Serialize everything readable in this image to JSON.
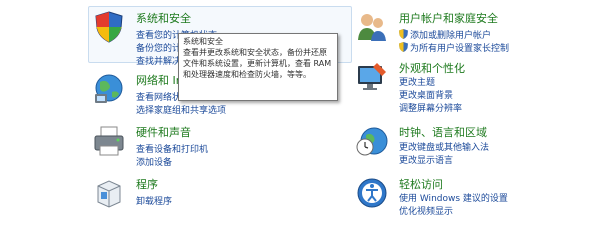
{
  "categories": [
    {
      "key": "system",
      "title": "系统和安全",
      "links": [
        "查看您的计算机状态",
        "备份您的计算机",
        "查找并解决问题"
      ]
    },
    {
      "key": "network",
      "title": "网络和 Internet",
      "links": [
        "查看网络状态和任务",
        "选择家庭组和共享选项"
      ]
    },
    {
      "key": "hardware",
      "title": "硬件和声音",
      "links": [
        "查看设备和打印机",
        "添加设备"
      ]
    },
    {
      "key": "programs",
      "title": "程序",
      "links": [
        "卸载程序"
      ]
    },
    {
      "key": "users",
      "title": "用户帐户和家庭安全",
      "links": [
        "添加或删除用户帐户",
        "为所有用户设置家长控制"
      ]
    },
    {
      "key": "appearance",
      "title": "外观和个性化",
      "links": [
        "更改主题",
        "更改桌面背景",
        "调整屏幕分辨率"
      ]
    },
    {
      "key": "clock",
      "title": "时钟、语言和区域",
      "links": [
        "更改键盘或其他输入法",
        "更改显示语言"
      ]
    },
    {
      "key": "ease",
      "title": "轻松访问",
      "links": [
        "使用 Windows 建议的设置",
        "优化视频显示"
      ]
    }
  ],
  "tooltip": {
    "title": "系统和安全",
    "body": "查看并更改系统和安全状态，备份并还原文件和系统设置，更新计算机，查看 RAM 和处理器速度和检查防火墙，等等。"
  },
  "icons": {
    "system": "shield-flag-icon",
    "network": "globe-network-icon",
    "hardware": "printer-icon",
    "programs": "program-box-icon",
    "users": "users-icon",
    "appearance": "paint-monitor-icon",
    "clock": "clock-globe-icon",
    "ease": "accessibility-icon",
    "uac": "uac-shield-icon"
  },
  "colors": {
    "category_title": "#1e7a1e",
    "link": "#1c4a9a"
  }
}
